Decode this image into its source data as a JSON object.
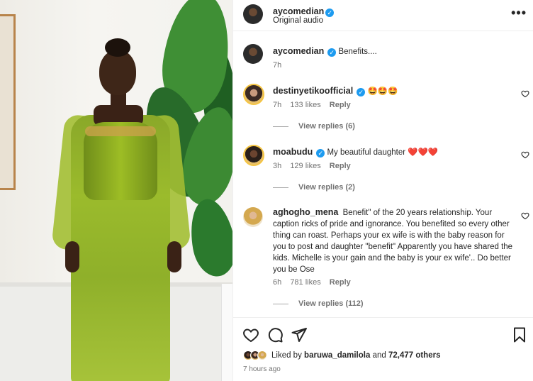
{
  "post": {
    "author": "aycomedian",
    "audio": "Original audio",
    "more_icon": "more-horizontal-icon"
  },
  "caption": {
    "username": "aycomedian",
    "text": "Benefits....",
    "time": "7h"
  },
  "comments": [
    {
      "username": "destinyetikoofficial",
      "text": "🤩🤩🤩",
      "time": "7h",
      "likes": "133 likes",
      "reply": "Reply",
      "view_replies": "View replies (6)"
    },
    {
      "username": "moabudu",
      "text": "My beautiful daughter ❤️❤️❤️",
      "time": "3h",
      "likes": "129 likes",
      "reply": "Reply",
      "view_replies": "View replies (2)"
    },
    {
      "username": "aghogho_mena",
      "text": "Benefit\" of the 20 years relationship. Your caption ricks of pride and ignorance. You benefited so every other thing can roast. Perhaps your ex wife is with the baby reason for you to post and daughter \"benefit\" Apparently you have shared the kids. Michelle is your gain and the baby is your ex wife'.. Do better you be Ose",
      "time": "6h",
      "likes": "781 likes",
      "reply": "Reply",
      "view_replies": "View replies (112)"
    }
  ],
  "footer": {
    "liked_by_prefix": "Liked by ",
    "liked_by_user": "baruwa_damilola",
    "liked_by_middle": " and ",
    "liked_by_count": "72,477 others",
    "time_ago": "7 hours ago"
  },
  "colors": {
    "verified": "#1d9bf0",
    "muted_text": "#737373",
    "primary_text": "#262626"
  }
}
